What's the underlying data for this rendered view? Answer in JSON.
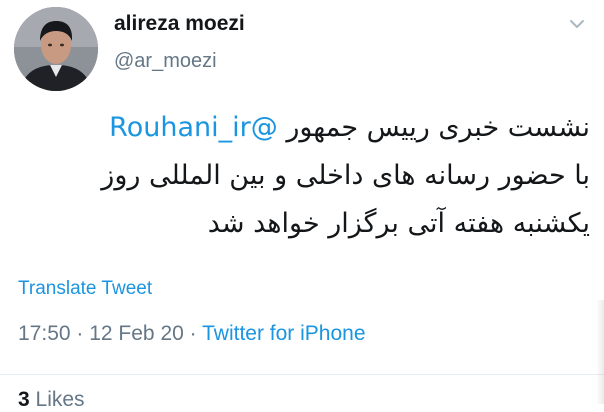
{
  "author": {
    "name": "alireza moezi",
    "handle": "@ar_moezi"
  },
  "tweet": {
    "mention": "@Rouhani_ir",
    "line1_text": "نشست خبری رییس جمهور ",
    "line2": "با حضور رسانه های داخلی و بین المللی روز",
    "line3": "یکشنبه هفته آتی برگزار خواهد شد"
  },
  "actions": {
    "translate": "Translate Tweet"
  },
  "meta": {
    "time": "17:50",
    "separator1": " · ",
    "date": "12 Feb 20",
    "separator2": " · ",
    "source": "Twitter for iPhone"
  },
  "stats": {
    "likes_count": "3",
    "likes_label": "Likes"
  },
  "icons": {
    "caret": "chevron-down-icon",
    "avatar": "avatar"
  },
  "colors": {
    "link": "#1b95e0",
    "secondary": "#657786",
    "text": "#14171a"
  }
}
